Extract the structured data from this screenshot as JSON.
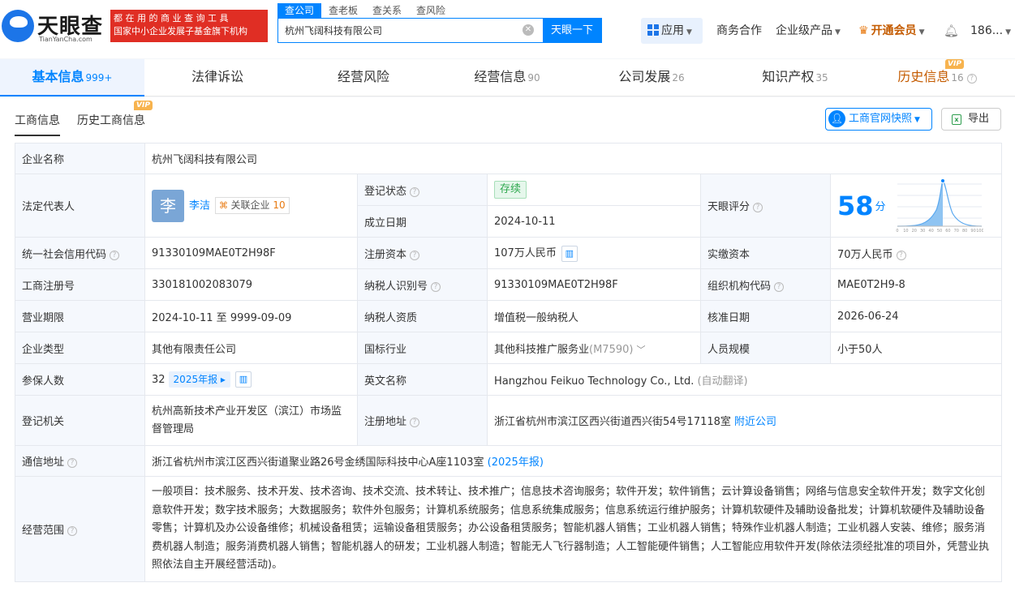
{
  "header": {
    "logo_text": "天眼查",
    "logo_sub": "TianYanCha.com",
    "slogan_line1": "都 在 用 的 商 业 查 询 工 具",
    "slogan_line2": "国家中小企业发展子基金旗下机构",
    "search_tabs": [
      "查公司",
      "查老板",
      "查关系",
      "查风险"
    ],
    "search_value": "杭州飞阔科技有限公司",
    "search_button": "天眼一下",
    "nav": {
      "apps": "应用",
      "business": "商务合作",
      "enterprise": "企业级产品",
      "vip": "开通会员",
      "user": "186..."
    }
  },
  "main_tabs": [
    {
      "label": "基本信息",
      "count": "999+"
    },
    {
      "label": "法律诉讼",
      "count": ""
    },
    {
      "label": "经营风险",
      "count": ""
    },
    {
      "label": "经营信息",
      "count": "90"
    },
    {
      "label": "公司发展",
      "count": "26"
    },
    {
      "label": "知识产权",
      "count": "35"
    },
    {
      "label": "历史信息",
      "count": "16"
    }
  ],
  "vip_label": "VIP",
  "sub_tabs": [
    "工商信息",
    "历史工商信息"
  ],
  "buttons": {
    "snapshot": "工商官网快照",
    "export": "导出"
  },
  "info": {
    "company_name_label": "企业名称",
    "company_name": "杭州飞阔科技有限公司",
    "legal_rep_label": "法定代表人",
    "legal_rep_avatar": "李",
    "legal_rep_name": "李洁",
    "assoc_label": "关联企业",
    "assoc_count": "10",
    "reg_status_label": "登记状态",
    "reg_status": "存续",
    "found_date_label": "成立日期",
    "found_date": "2024-10-11",
    "score_label": "天眼评分",
    "score": "58",
    "score_unit": "分",
    "score_axis": [
      "0",
      "10",
      "20",
      "30",
      "40",
      "50",
      "60",
      "70",
      "80",
      "90",
      "100"
    ],
    "credit_code_label": "统一社会信用代码",
    "credit_code": "91330109MAE0T2H98F",
    "reg_capital_label": "注册资本",
    "reg_capital": "107万人民币",
    "paid_capital_label": "实缴资本",
    "paid_capital": "70万人民币",
    "reg_no_label": "工商注册号",
    "reg_no": "330181002083079",
    "taxpayer_id_label": "纳税人识别号",
    "taxpayer_id": "91330109MAE0T2H98F",
    "org_code_label": "组织机构代码",
    "org_code": "MAE0T2H9-8",
    "term_label": "营业期限",
    "term": "2024-10-11 至 9999-09-09",
    "taxpayer_qual_label": "纳税人资质",
    "taxpayer_qual": "增值税一般纳税人",
    "approve_date_label": "核准日期",
    "approve_date": "2026-06-24",
    "type_label": "企业类型",
    "type": "其他有限责任公司",
    "industry_label": "国标行业",
    "industry": "其他科技推广服务业",
    "industry_code": "(M7590)",
    "staff_size_label": "人员规模",
    "staff_size": "小于50人",
    "insured_label": "参保人数",
    "insured": "32",
    "insured_report": "2025年报",
    "english_label": "英文名称",
    "english": "Hangzhou Feikuo Technology Co., Ltd.",
    "english_note": "(自动翻译)",
    "authority_label": "登记机关",
    "authority": "杭州高新技术产业开发区（滨江）市场监督管理局",
    "address_label": "注册地址",
    "address": "浙江省杭州市滨江区西兴街道西兴街54号17118室",
    "nearby": "附近公司",
    "mail_label": "通信地址",
    "mail": "浙江省杭州市滨江区西兴街道聚业路26号金绣国际科技中心A座1103室",
    "mail_report": "(2025年报)",
    "scope_label": "经营范围",
    "scope": "一般项目：技术服务、技术开发、技术咨询、技术交流、技术转让、技术推广；信息技术咨询服务；软件开发；软件销售；云计算设备销售；网络与信息安全软件开发；数字文化创意软件开发；数字技术服务；大数据服务；软件外包服务；计算机系统服务；信息系统集成服务；信息系统运行维护服务；计算机软硬件及辅助设备批发；计算机软硬件及辅助设备零售；计算机及办公设备维修；机械设备租赁；运输设备租赁服务；办公设备租赁服务；智能机器人销售；工业机器人销售；特殊作业机器人制造；工业机器人安装、维修；服务消费机器人制造；服务消费机器人销售；智能机器人的研发；工业机器人制造；智能无人飞行器制造；人工智能硬件销售；人工智能应用软件开发(除依法须经批准的项目外，凭营业执照依法自主开展经营活动)。"
  }
}
